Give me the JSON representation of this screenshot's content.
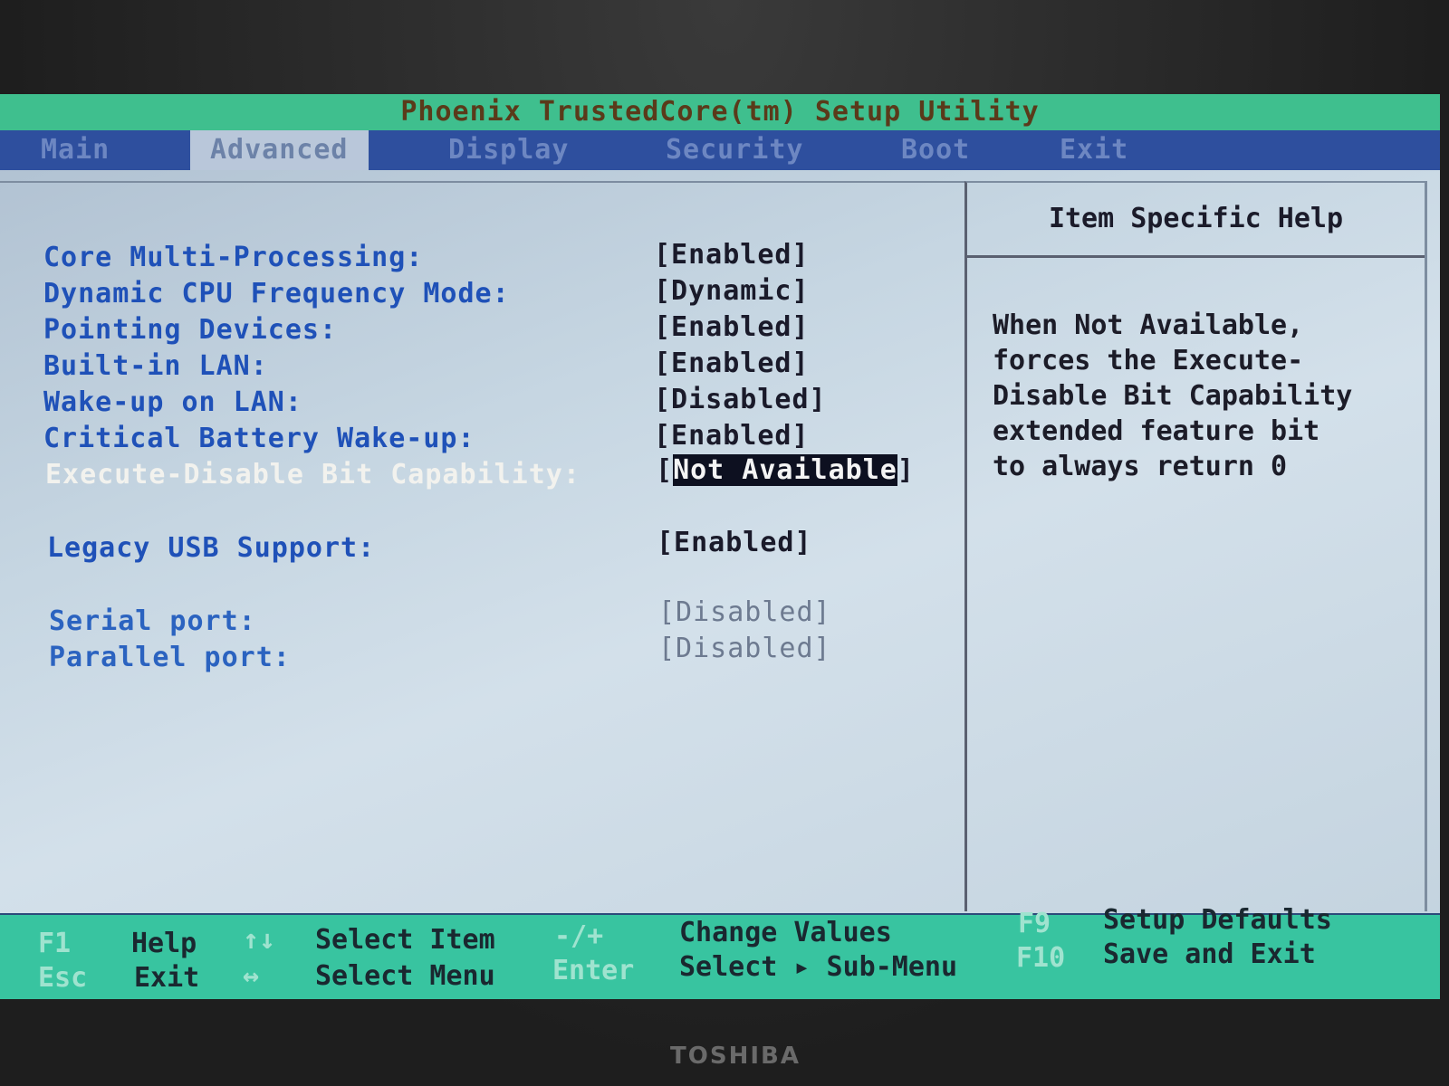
{
  "title": "Phoenix TrustedCore(tm) Setup Utility",
  "menu": [
    {
      "label": "Main"
    },
    {
      "label": "Advanced"
    },
    {
      "label": "Display"
    },
    {
      "label": "Security"
    },
    {
      "label": "Boot"
    },
    {
      "label": "Exit"
    }
  ],
  "active_tab": "Advanced",
  "settings": [
    {
      "label": "Core Multi-Processing:",
      "value": "[Enabled]"
    },
    {
      "label": "Dynamic CPU Frequency Mode:",
      "value": "[Dynamic]"
    },
    {
      "label": "Pointing Devices:",
      "value": "[Enabled]"
    },
    {
      "label": "Built-in LAN:",
      "value": "[Enabled]"
    },
    {
      "label": "Wake-up on LAN:",
      "value": "[Disabled]"
    },
    {
      "label": "Critical Battery Wake-up:",
      "value": "[Enabled]"
    },
    {
      "label": "Execute-Disable Bit Capability:",
      "value_open": "[",
      "value": "Not Available",
      "value_close": "]"
    },
    {
      "label": "Legacy USB Support:",
      "value": "[Enabled]"
    },
    {
      "label": "Serial port:",
      "value": "[Disabled]"
    },
    {
      "label": "Parallel port:",
      "value": "[Disabled]"
    }
  ],
  "help": {
    "title": "Item Specific Help",
    "lines": [
      "When Not Available,",
      "forces the Execute-",
      "Disable Bit Capability",
      "extended feature bit",
      "to always return 0"
    ]
  },
  "footer": {
    "f1_key": "F1",
    "f1_text": "Help",
    "esc_key": "Esc",
    "esc_text": "Exit",
    "updown_key": "↑↓",
    "updown_text": "Select Item",
    "leftright_key": "↔",
    "leftright_text": "Select Menu",
    "minusplus_key": "-/+",
    "minusplus_text": "Change Values",
    "enter_key": "Enter",
    "enter_text": "Select ▸ Sub-Menu",
    "f9_key": "F9",
    "f9_text": "Setup Defaults",
    "f10_key": "F10",
    "f10_text": "Save and Exit"
  },
  "brand": "TOSHIBA",
  "colors": {
    "title_bar": "#3fbf8e",
    "menu_bar": "#2e4f9e",
    "label": "#1f51b8",
    "selected_label": "#f2f2ee",
    "highlight_bg": "#0d1020",
    "footer": "#38c4a0"
  }
}
